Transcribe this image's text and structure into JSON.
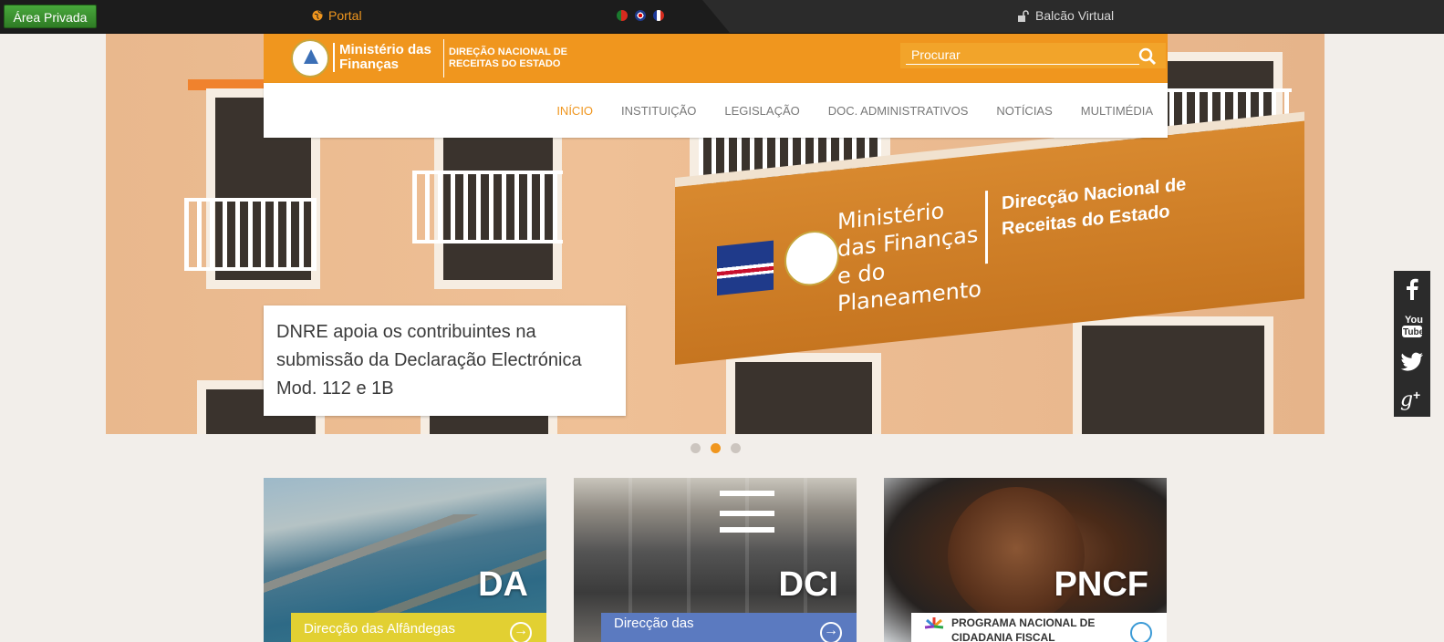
{
  "topbar": {
    "private_area": "Área Privada",
    "portal": "Portal",
    "balcao": "Balcão Virtual"
  },
  "header": {
    "logo_name": "Ministério das Finanças",
    "logo_sub": "DIREÇÃO NACIONAL DE RECEITAS DO ESTADO",
    "search_placeholder": "Procurar"
  },
  "nav": {
    "items": [
      "INÍCIO",
      "INSTITUIÇÃO",
      "LEGISLAÇÃO",
      "DOC. ADMINISTRATIVOS",
      "NOTÍCIAS",
      "MULTIMÉDIA"
    ]
  },
  "hero": {
    "sign_title": "Ministério das Finanças e do Planeamento",
    "sign_sub": "Direcção Nacional de Receitas do Estado",
    "caption": "DNRE apoia os contribuintes na submissão da Declaração Electrónica Mod. 112 e 1B"
  },
  "cards": [
    {
      "title": "DA",
      "label": "Direcção das Alfândegas",
      "color": "#e2d032"
    },
    {
      "title": "DCI",
      "label": "Direcção das",
      "color": "#5b7ac0"
    },
    {
      "title": "PNCF",
      "label": "PROGRAMA NACIONAL DE CIDADANIA FISCAL",
      "color": "#ffffff"
    }
  ],
  "social": [
    "facebook-icon",
    "youtube-icon",
    "twitter-icon",
    "google-plus-icon"
  ],
  "colors": {
    "accent": "#f0961e",
    "topbar": "#2b2b2b"
  }
}
